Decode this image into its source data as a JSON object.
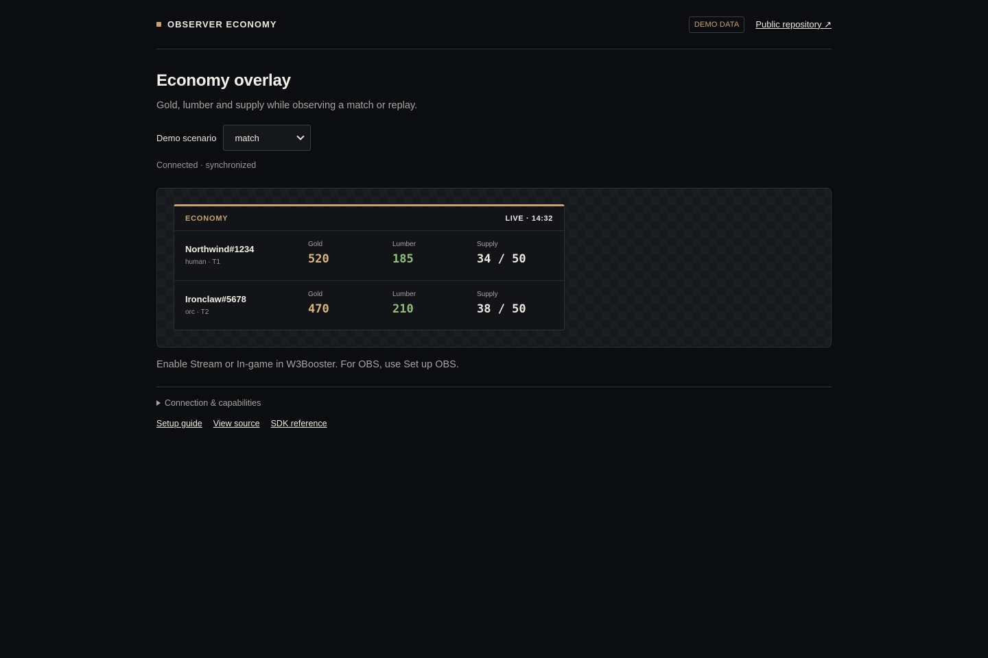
{
  "header": {
    "brand": "OBSERVER ECONOMY",
    "badge": "DEMO DATA",
    "repo_link": "Public repository ↗"
  },
  "page": {
    "title": "Economy overlay",
    "subtitle": "Gold, lumber and supply while observing a match or replay."
  },
  "scenario": {
    "label": "Demo scenario",
    "selected": "match"
  },
  "status": "Connected · synchronized",
  "panel": {
    "title": "ECONOMY",
    "live": "LIVE · 14:32",
    "stat_labels": {
      "gold": "Gold",
      "lumber": "Lumber",
      "supply": "Supply"
    },
    "players": [
      {
        "name": "Northwind#1234",
        "meta": "human · T1",
        "gold": "520",
        "lumber": "185",
        "supply": "34 / 50"
      },
      {
        "name": "Ironclaw#5678",
        "meta": "orc · T2",
        "gold": "470",
        "lumber": "210",
        "supply": "38 / 50"
      }
    ]
  },
  "note": "Enable Stream or In-game in W3Booster. For OBS, use Set up OBS.",
  "details_summary": "Connection & capabilities",
  "footer_links": [
    "Setup guide",
    "View source",
    "SDK reference"
  ],
  "colors": {
    "accent": "#c9a46a",
    "gold": "#d6b679",
    "lumber": "#8fbf7a",
    "background": "#0c0d10"
  }
}
